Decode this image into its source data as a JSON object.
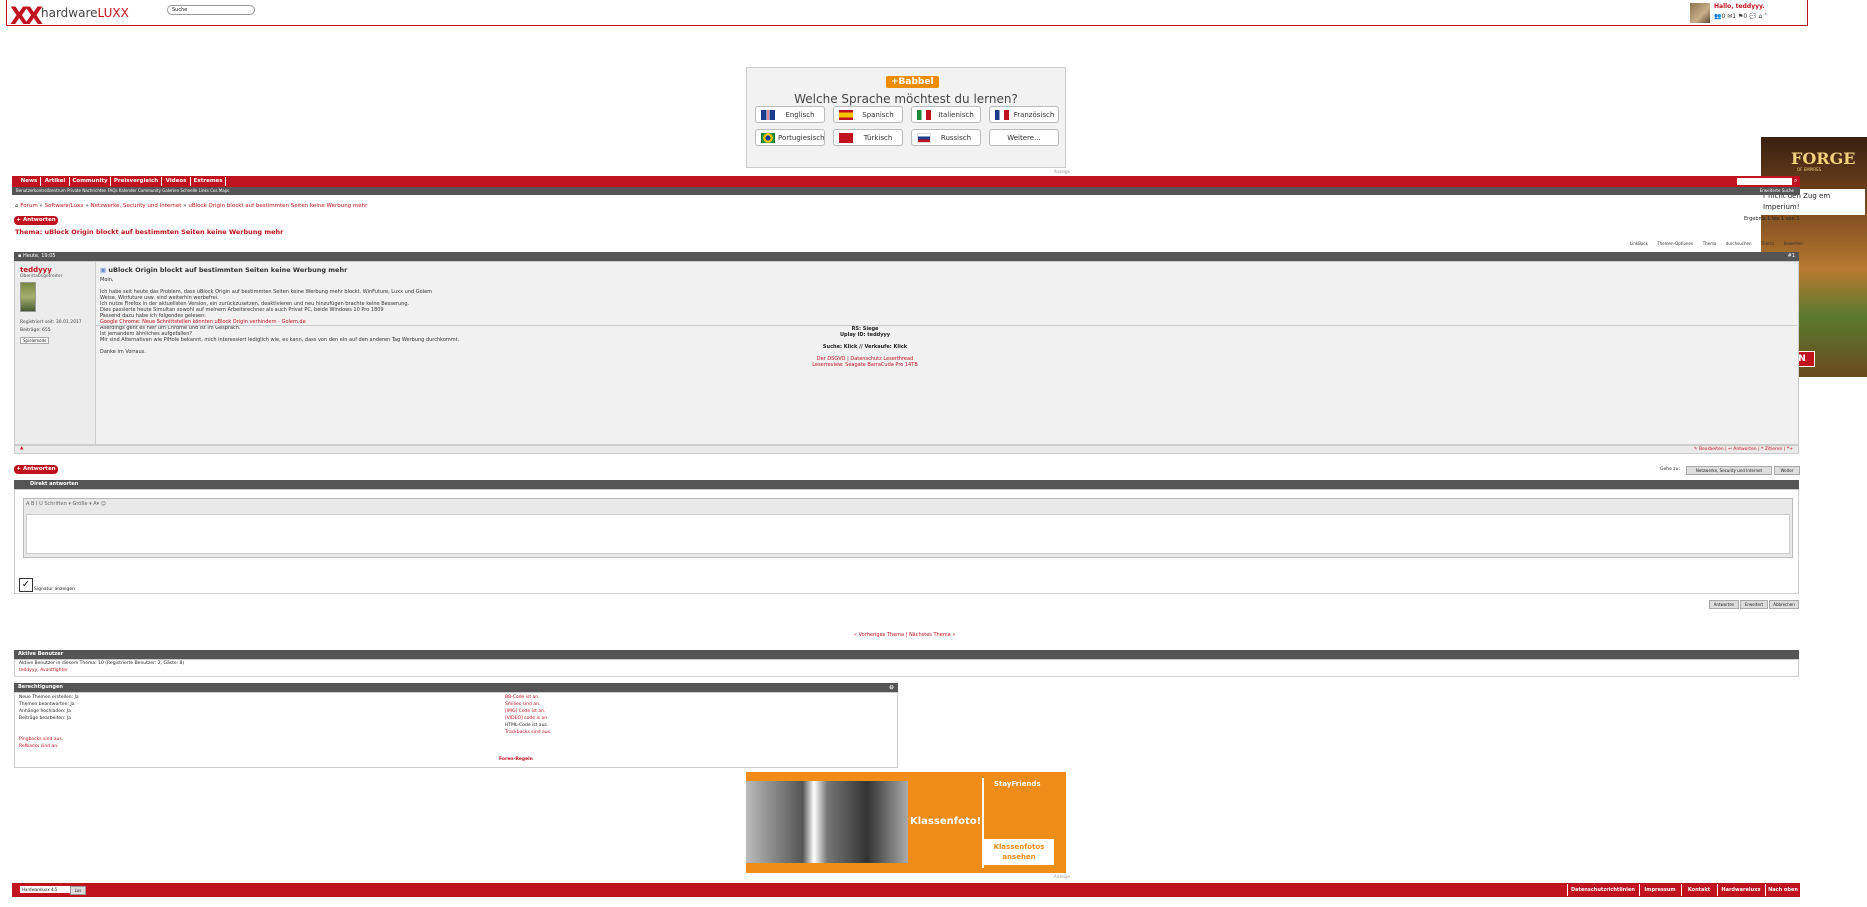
{
  "header": {
    "logo_mark": "XX",
    "logo_word_1": "hardware",
    "logo_word_2": "LUXX",
    "search_placeholder": "Suche",
    "greeting": "Hallo, teddyyy.",
    "icon_counts": [
      "0",
      "1",
      "0"
    ]
  },
  "babbel_ad": {
    "logo": "+Babbel",
    "question": "Welche Sprache möchtest du lernen?",
    "languages": [
      "Englisch",
      "Spanisch",
      "Italienisch",
      "Französisch",
      "Portugiesisch",
      "Türkisch",
      "Russisch",
      "Weitere..."
    ],
    "ad_tag": "Anzeige"
  },
  "side_ad": {
    "title": "FORGE",
    "subtitle": "OF EMPIRES",
    "text": "r nicht den Zug em Imperium!",
    "button": "PIELEN"
  },
  "navbar": {
    "tabs": [
      "News",
      "Artikel",
      "Community",
      "Preisvergleich",
      "Videos",
      "Extremes"
    ],
    "subnav": "Benutzerkontrollzentrum  Private Nachrichten  FAQs  Kalender  Community  Galerien  Schnelle Links  Cos Maps",
    "advanced_search": "Erweiterte Suche"
  },
  "breadcrumb": [
    "Forum",
    "Software/Luxx",
    "Netzwerke, Security und Internet",
    "uBlock Origin blockt auf bestimmten Seiten keine Werbung mehr"
  ],
  "reply_button": "Antworten",
  "thread": {
    "title_prefix": "Thema:",
    "title": "uBlock Origin blockt auf bestimmten Seiten keine Werbung mehr",
    "results": "Ergebnis 1 bis 1 von 1",
    "tools": [
      "LinkBack",
      "Themen-Optionen",
      "Thema durchsuchen",
      "Thema bewerten"
    ]
  },
  "post": {
    "date": "Heute, 19:05",
    "number": "#1",
    "username": "teddyyy",
    "user_title": "Oberstabsgefreiter",
    "registered": "Registriert seit: 30.01.2017",
    "posts": "Beiträge: 655",
    "badge": "Spielemods",
    "title": "uBlock Origin blockt auf bestimmten Seiten keine Werbung mehr",
    "body": "Moin,\n\nIch habe seit heute das Problem, dass uBlock Origin auf bestimmten Seiten keine Werbung mehr blockt. WinFuture, Luxx und Golem\nWeise, Winfuture usw. sind weiterhin werbefrei.\nIch nutze Firefox in der aktuellsten Version, ein zurückzusetzen, deaktivieren und neu hinzufügen brachte keine Besserung.\nDies passierte heute Simultan sowohl auf meinem Arbeitsrechner als auch Privat PC, beide Windows 10 Pro 1809\nPassend dazu habe ich folgendes gelesen:",
    "link": "Google Chrome: Neue Schnittstellen könnten uBlock Origin verhindern - Golem.de",
    "body2": "Allerdings geht es hier um Chrome und ist im Gespräch.\nIst jemandem ähnliches aufgefallen?\nMir sind Alternativen wie PiHole bekannt, mich interessiert lediglich wie, es kann, dass von den ein auf den anderen Tag Werbung durchkommt.\n\nDanke im Vorraus.",
    "sig_lines": [
      "RS: Siege",
      "Uplay ID: teddyyy"
    ],
    "sig_search": "Suche: Klick // Verkaufe: Klick",
    "sig_links": [
      "Der DSGVO | Datenschutz Leserthread",
      "Leserreview: Seagate BarraCuda Pro 14TB"
    ],
    "actions": [
      "Bearbeiten",
      "Antworten",
      "Zitieren"
    ]
  },
  "goto": {
    "label": "Gehe zu:",
    "select": "Netzwerke, Security und Internet",
    "button": "Weiter"
  },
  "quick_reply": {
    "title": "Direkt antworten",
    "toolbar": "A  B  I  U   Schriften ▾   Größe ▾   A▾   ☺",
    "signature_label": "Signatur anzeigen",
    "buttons": [
      "Antworten",
      "Erweitert",
      "Abbrechen"
    ]
  },
  "prevnext": "« Vorheriges Thema | Nächstes Thema »",
  "active_users": {
    "title": "Aktive Benutzer",
    "line": "Aktive Benutzer in diesem Thema: 10 (Registrierte Benutzer: 2, Gäste: 8)",
    "users": "teddyyy,  Avantfighter"
  },
  "permissions": {
    "title": "Berechtigungen",
    "left": [
      "Neue Themen erstellen: Ja",
      "Themen beantworten: Ja",
      "Anhänge hochladen: Ja",
      "Beiträge bearbeiten: Ja"
    ],
    "left2": [
      "Pingbacks sind aus.",
      "Refbacks sind an."
    ],
    "right": [
      "BB-Code ist an.",
      "Smilies sind an.",
      "[IMG] Code ist an.",
      "[VIDEO] code is on",
      "HTML-Code ist aus.",
      "Trackbacks sind aus."
    ],
    "rules": "Foren-Regeln"
  },
  "stayfriends": {
    "brand": "StayFriends",
    "headline": "Klassenfoto!",
    "cta": "Klassenfotos ansehen"
  },
  "footer": {
    "style": "Hardwareluxx 4.5",
    "go": "Los",
    "links": [
      "Datenschutzrichtlinien",
      "Impressum",
      "Kontakt",
      "Hardwareluxx",
      "Nach oben"
    ]
  },
  "colors": {
    "brand_red": "#c1121f",
    "dark_header": "#555555",
    "babbel_orange": "#f08c00"
  }
}
